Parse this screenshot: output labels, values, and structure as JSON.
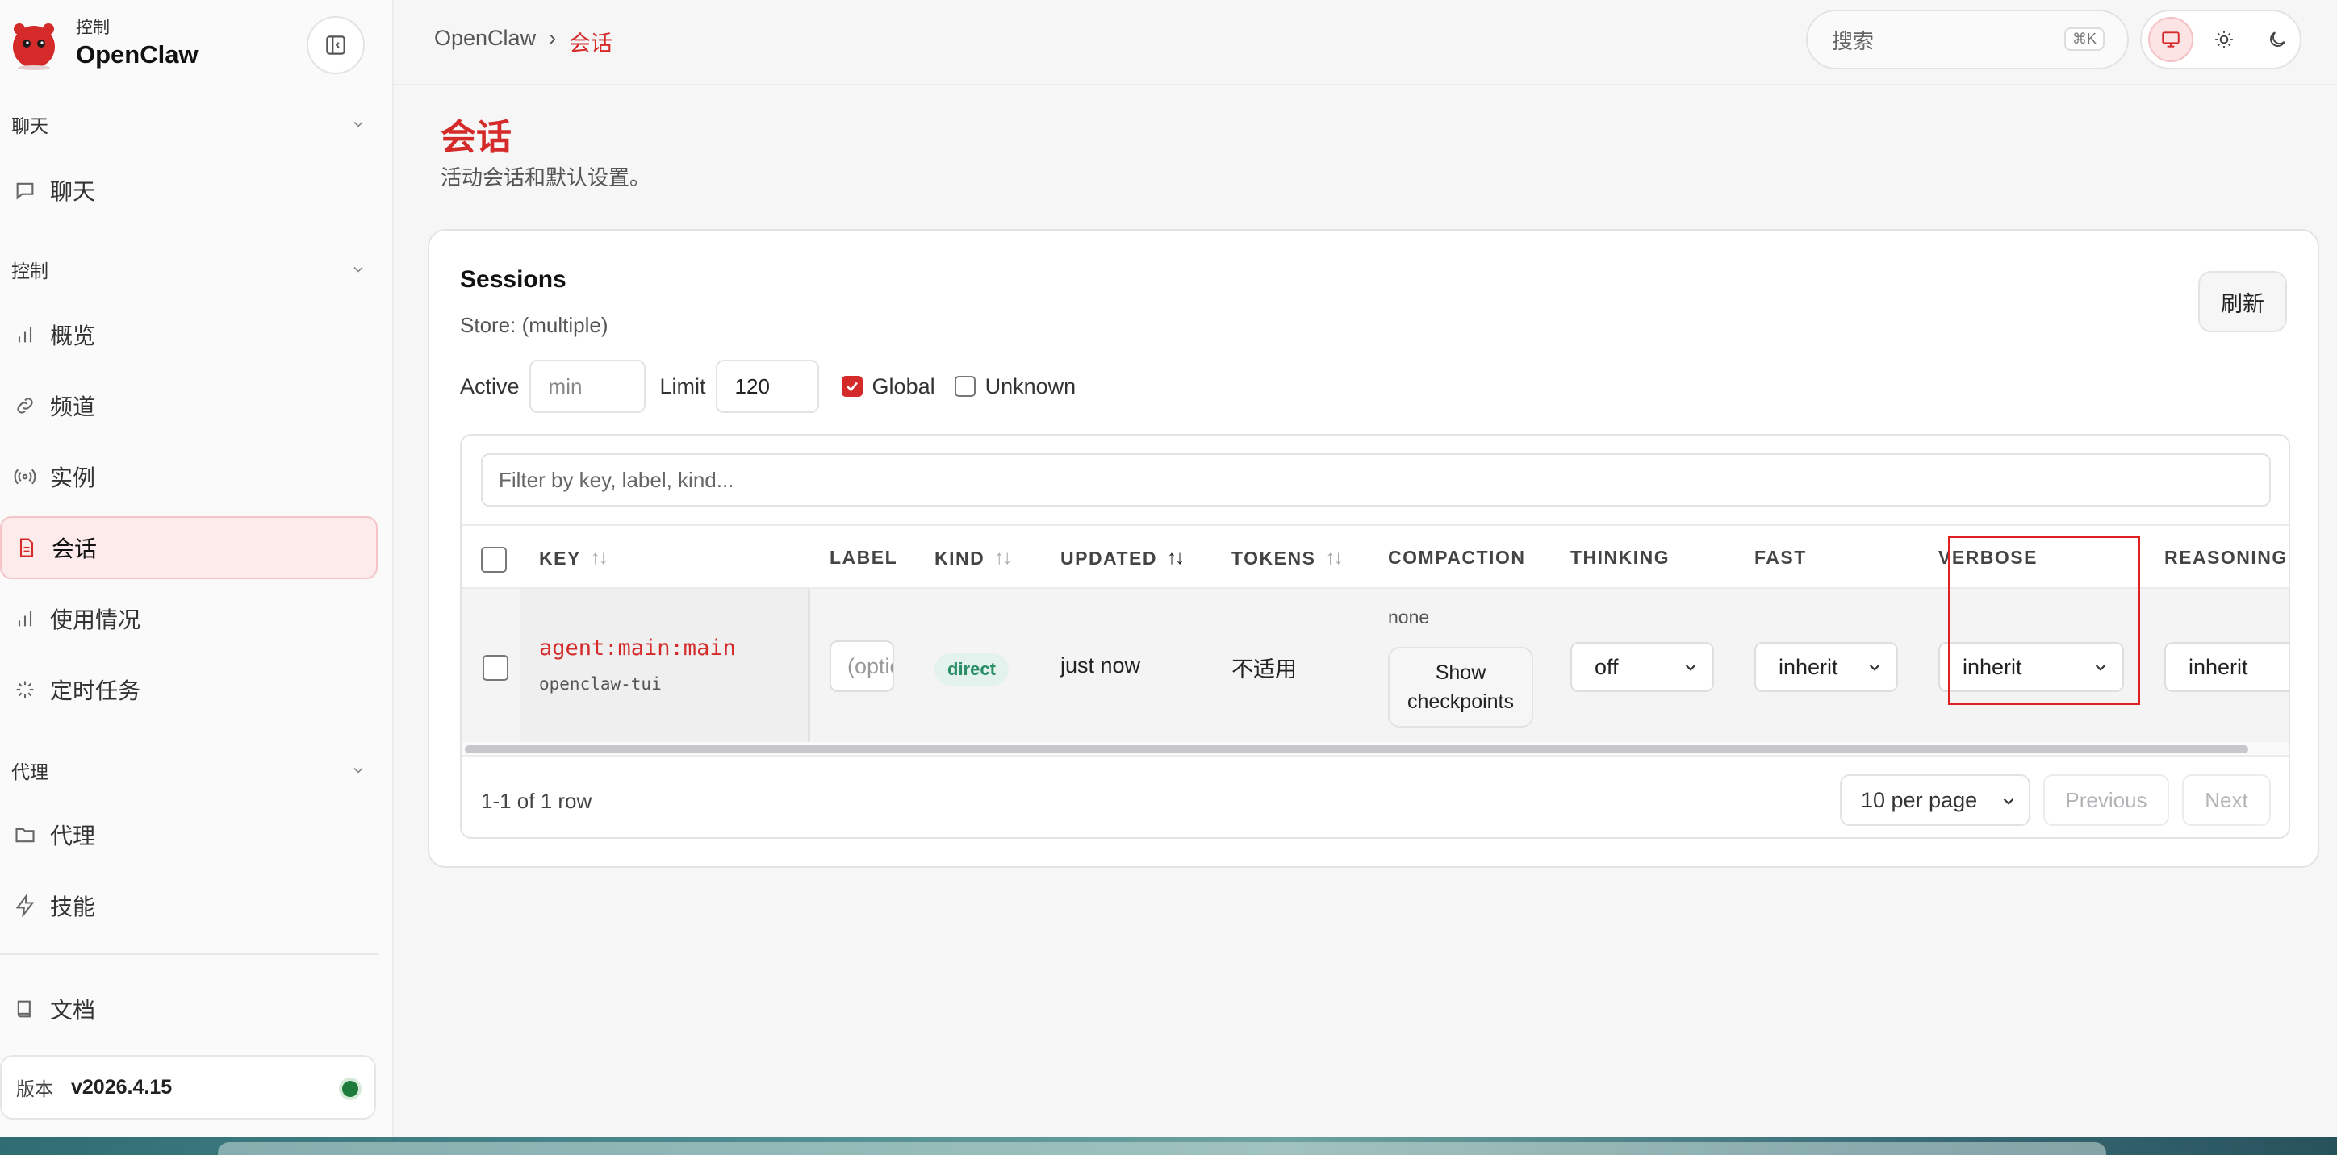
{
  "brand": {
    "sub": "控制",
    "name": "OpenClaw"
  },
  "sidebar": {
    "sections": [
      {
        "label": "聊天"
      },
      {
        "label": "控制"
      },
      {
        "label": "代理"
      }
    ],
    "items": [
      {
        "label": "聊天",
        "icon": "chat-bubble-icon"
      },
      {
        "label": "概览",
        "icon": "bar-chart-icon"
      },
      {
        "label": "频道",
        "icon": "link-icon"
      },
      {
        "label": "实例",
        "icon": "radio-signal-icon"
      },
      {
        "label": "会话",
        "icon": "document-icon",
        "active": true
      },
      {
        "label": "使用情况",
        "icon": "bar-chart-icon"
      },
      {
        "label": "定时任务",
        "icon": "loader-icon"
      },
      {
        "label": "代理",
        "icon": "folder-icon"
      },
      {
        "label": "技能",
        "icon": "lightning-icon"
      },
      {
        "label": "文档",
        "icon": "book-icon"
      }
    ],
    "version_label": "版本",
    "version": "v2026.4.15"
  },
  "topbar": {
    "breadcrumb_root": "OpenClaw",
    "breadcrumb_sep": "›",
    "breadcrumb_current": "会话",
    "search_placeholder": "搜索",
    "search_shortcut": "⌘K"
  },
  "page": {
    "title": "会话",
    "subtitle": "活动会话和默认设置。"
  },
  "card": {
    "title": "Sessions",
    "store": "Store: (multiple)",
    "refresh_label": "刷新",
    "active_label": "Active",
    "active_placeholder": "min",
    "limit_label": "Limit",
    "limit_value": "120",
    "global_label": "Global",
    "global_checked": true,
    "unknown_label": "Unknown",
    "unknown_checked": false
  },
  "table": {
    "filter_placeholder": "Filter by key, label, kind...",
    "columns": [
      "KEY",
      "LABEL",
      "KIND",
      "UPDATED",
      "TOKENS",
      "COMPACTION",
      "THINKING",
      "FAST",
      "VERBOSE",
      "REASONING"
    ],
    "rows": [
      {
        "key": "agent:main:main",
        "key_sub": "openclaw-tui",
        "label_placeholder": "(optional)",
        "kind": "direct",
        "updated": "just now",
        "tokens": "不适用",
        "compaction": "none",
        "compaction_button_line1": "Show",
        "compaction_button_line2": "checkpoints",
        "thinking": "off",
        "fast": "inherit",
        "verbose": "inherit",
        "reasoning": "inherit"
      }
    ],
    "row_count": "1-1 of 1 row",
    "per_page": "10 per page",
    "previous": "Previous",
    "next": "Next"
  },
  "colors": {
    "accent": "#d42a2a",
    "status_ok": "#1d7a3a"
  }
}
